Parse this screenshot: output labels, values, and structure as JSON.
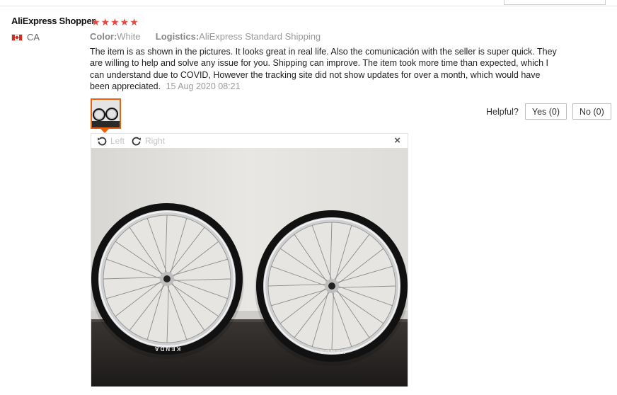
{
  "review": {
    "user_name": "AliExpress Shopper",
    "rating_stars": "★★★★★",
    "country_code": "CA",
    "color_label": "Color:",
    "color_value": "White",
    "logistics_label": "Logistics:",
    "logistics_value": "AliExpress Standard Shipping",
    "text": "The item is as shown in the pictures. It looks great in real life. Also the comunicación with the seller is super quick. They are willing to help and solve any issue for you. Shipping can improve. The item took more time than expected, which I can understand due to COVID, However the tracking site did not show updates for over a month, which would have been appreciated.",
    "date": "15 Aug 2020 08:21"
  },
  "helpful": {
    "label": "Helpful?",
    "yes_label": "Yes (0)",
    "no_label": "No (0)"
  },
  "viewer": {
    "rotate_left": "Left",
    "rotate_right": "Right",
    "close": "×",
    "tire_brand": "KENDA"
  },
  "colors": {
    "star": "#e8473f",
    "thumb_border": "#e8640c",
    "muted_text": "#999999"
  }
}
